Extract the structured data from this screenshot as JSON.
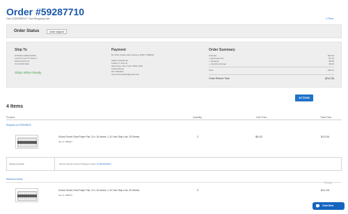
{
  "header": {
    "title": "Order #59287710",
    "subtitle": "Cart 12322399013 / Your Shopping Cart",
    "print_label": "Print"
  },
  "status": {
    "label": "Order Status",
    "value": "Order shipped"
  },
  "ship_to": {
    "heading": "Ship To",
    "lines": [
      "STEFAN GEECHAPAH",
      "1213 CLYCH ST STE H",
      "SANTA ANA CA",
      "US 92705-5042"
    ],
    "ships_when": "Ships When Ready"
  },
  "payment": {
    "heading": "Payment",
    "method": "By VISA Credit Card ending in 8030 / PREPAY",
    "lines": [
      "Stefan Geecheran",
      "12322 17 STH St",
      "Santa Ana, New York 13454-1842",
      "United States",
      "847 4564332",
      "sesecurtmeails31@gmail.com"
    ]
  },
  "summary": {
    "heading": "Order Summary",
    "rows": [
      {
        "label": "Subtotal",
        "value": "$13.04"
      },
      {
        "label": "+ Estimated Tax",
        "value": "$1.15"
      },
      {
        "label": "+ Shipping",
        "value": "$9.83"
      },
      {
        "label": "+ Handling Charge",
        "value": "$0.00"
      }
    ],
    "total_label": "Total",
    "total_value": "$30.11",
    "refund_label": "Order Refund Total",
    "refund_value": "($14.25)"
  },
  "actions_label": "ACTIONS",
  "items": {
    "count_label": "4 Items",
    "columns": {
      "product": "Product",
      "quantity": "Quantity",
      "unit_price": "Unit Price",
      "total_price": "Total Price"
    },
    "shipped_label": "Shipped on 2022/06/11",
    "shipped_item": {
      "name": "School Smart Chart Paper Pad, 24 x 16 Inches, 1-1/2 Inch Skip Line, 25 Sheets",
      "sku": "Item #: 085207",
      "quantity": "2",
      "unit_price": "$6.52",
      "total_price": "$13.04"
    },
    "shipping_details_label": "Shipping Details",
    "tracking_text": "Fed Ex Parcel Ground Tracking number:",
    "tracking_number": "#73622999232",
    "returned_label": "Returned Items",
    "refund_col_label": "Refund",
    "returned_item": {
      "name": "School Smart Chart Paper Pad, 24 x 16 Inches, 1-1/2 Inch Skip Line, 25 Sheets",
      "sku": "Item #: 085207",
      "quantity": "2",
      "refund": "$14.25"
    }
  },
  "chat_label": "Chat Now",
  "colors": {
    "brand_blue": "#1a57a8",
    "link_blue": "#1f72c9",
    "ship_green": "#4aa34a",
    "chat_blue": "#1565c0"
  }
}
